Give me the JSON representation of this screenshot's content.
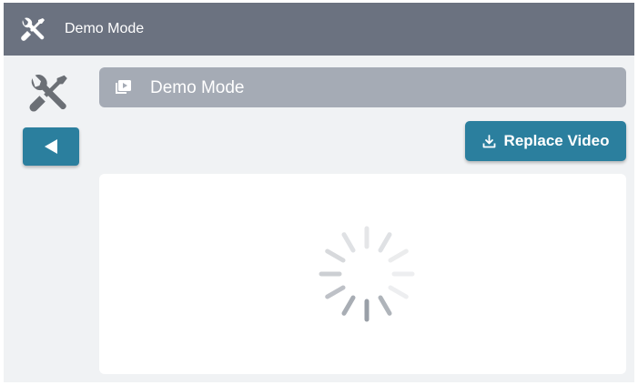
{
  "window": {
    "title": "Demo Mode",
    "icon": "tools-icon"
  },
  "sidebar": {
    "icon": "tools-icon",
    "back_button": {
      "icon": "triangle-left-icon"
    }
  },
  "header": {
    "icon": "video-library-icon",
    "title": "Demo Mode"
  },
  "toolbar": {
    "replace_label": "Replace Video",
    "replace_icon": "download-icon"
  },
  "content": {
    "state": "loading",
    "spinner_icon": "loading-spinner-icon"
  },
  "colors": {
    "titlebar": "#6b7280",
    "header_bar": "#a5abb5",
    "accent": "#2b7f9e",
    "background": "#f0f2f4",
    "panel": "#ffffff"
  }
}
